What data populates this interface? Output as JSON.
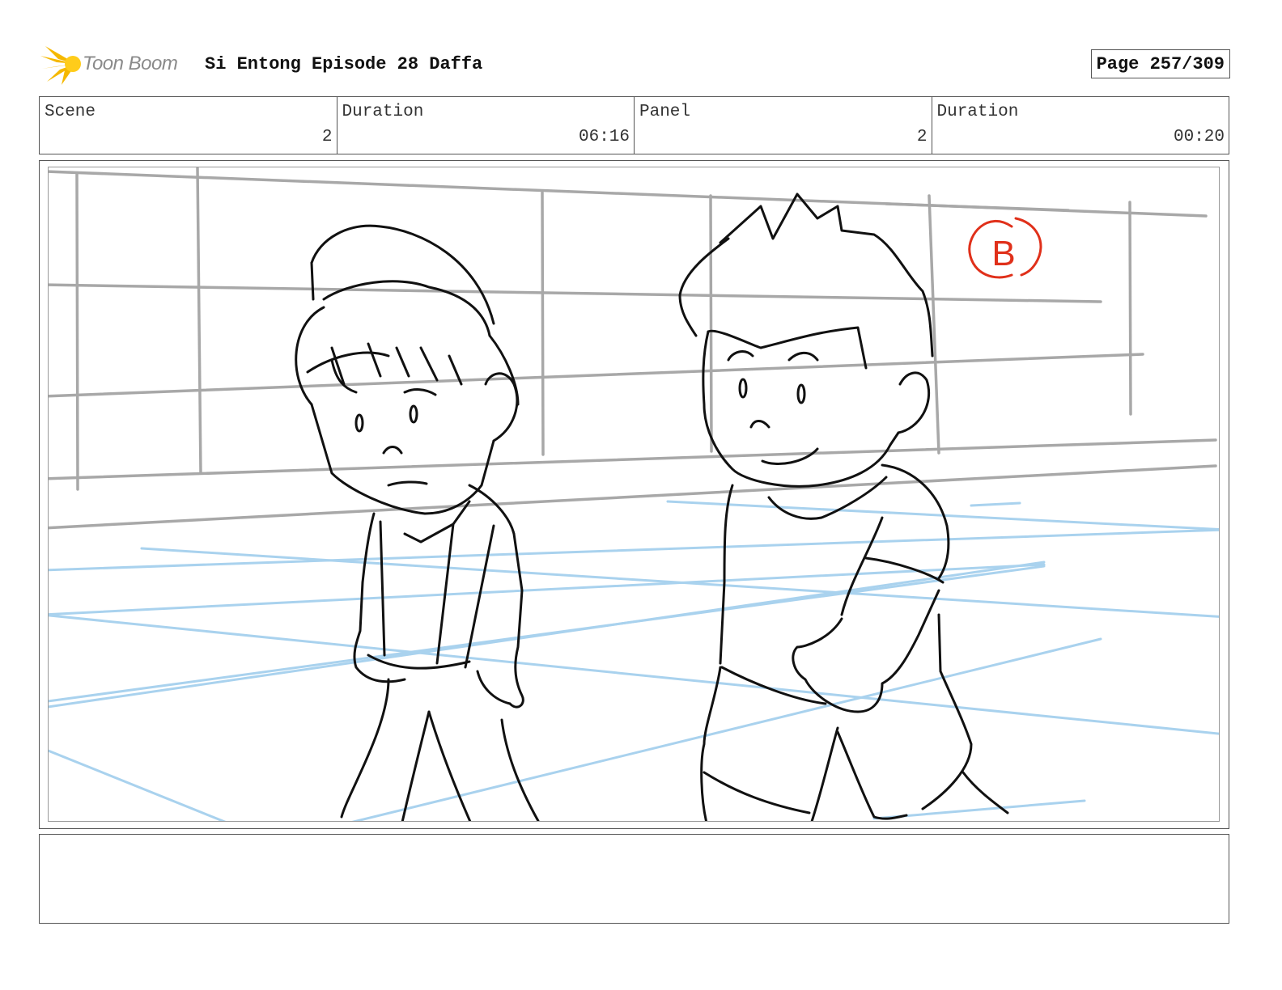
{
  "header": {
    "logo_text": "Toon Boom",
    "title": "Si Entong Episode 28 Daffa",
    "page": "Page 257/309"
  },
  "info": [
    {
      "label": "Scene",
      "value": "2"
    },
    {
      "label": "Duration",
      "value": "06:16"
    },
    {
      "label": "Panel",
      "value": "2"
    },
    {
      "label": "Duration",
      "value": "00:20"
    }
  ],
  "panel": {
    "marker": "B"
  },
  "notes": {
    "text": ""
  },
  "colors": {
    "sketch_line": "#111111",
    "wall_line": "#a8a8a8",
    "floor_line": "#a9d2ee",
    "marker": "#e0301a",
    "logo_star": "#f5b800"
  }
}
